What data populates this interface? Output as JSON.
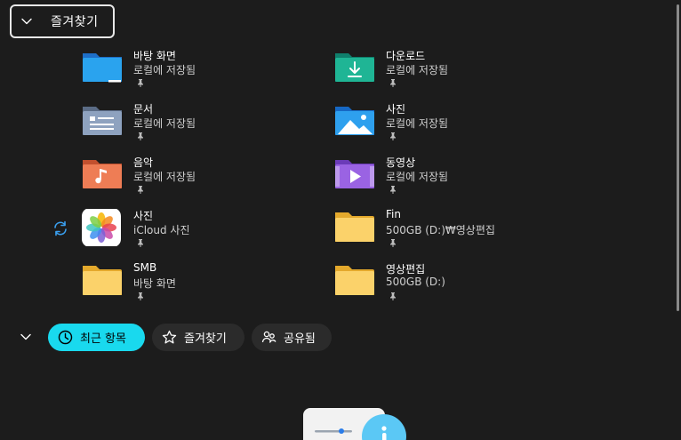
{
  "favorites": {
    "header": "즐겨찾기",
    "items": [
      {
        "name": "바탕 화면",
        "location": "로컬에 저장됨",
        "icon": "desktop-folder-icon",
        "pinned": true
      },
      {
        "name": "다운로드",
        "location": "로컬에 저장됨",
        "icon": "downloads-folder-icon",
        "pinned": true
      },
      {
        "name": "문서",
        "location": "로컬에 저장됨",
        "icon": "documents-folder-icon",
        "pinned": true
      },
      {
        "name": "사진",
        "location": "로컬에 저장됨",
        "icon": "pictures-folder-icon",
        "pinned": true
      },
      {
        "name": "음악",
        "location": "로컬에 저장됨",
        "icon": "music-folder-icon",
        "pinned": true
      },
      {
        "name": "동영상",
        "location": "로컬에 저장됨",
        "icon": "videos-folder-icon",
        "pinned": true
      },
      {
        "name": "사진",
        "location": "iCloud 사진",
        "icon": "icloud-photos-icon",
        "pinned": true
      },
      {
        "name": "Fin",
        "location": "500GB (D:)₩영상편집",
        "icon": "folder-icon",
        "pinned": true
      },
      {
        "name": "SMB",
        "location": "바탕 화면",
        "icon": "folder-icon",
        "pinned": true
      },
      {
        "name": "영상편집",
        "location": "500GB (D:)",
        "icon": "folder-icon",
        "pinned": true
      }
    ]
  },
  "recent_tabs": [
    {
      "label": "최근 항목",
      "icon": "clock-icon",
      "active": true
    },
    {
      "label": "즐겨찾기",
      "icon": "star-icon",
      "active": false
    },
    {
      "label": "공유됨",
      "icon": "people-icon",
      "active": false
    }
  ],
  "colors": {
    "accent": "#19d9ee",
    "background": "#1c1c1c",
    "pill": "#2b2b2b"
  }
}
